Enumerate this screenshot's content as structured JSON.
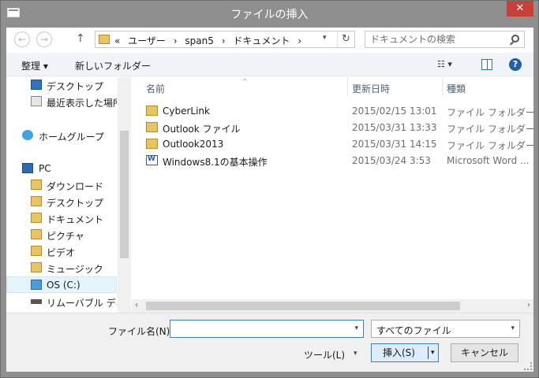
{
  "window": {
    "title": "ファイルの挿入",
    "close_glyph": "✕"
  },
  "nav": {
    "back": "←",
    "forward": "→",
    "up": "↑"
  },
  "address": {
    "path": [
      "«",
      "ユーザー",
      "›",
      "span5",
      "›",
      "ドキュメント",
      "›"
    ],
    "refresh": "↻"
  },
  "search": {
    "placeholder": "ドキュメントの検索"
  },
  "toolbar": {
    "organize": "整理 ▾",
    "new_folder": "新しいフォルダー",
    "view": "☷ ▾",
    "help": "?"
  },
  "navpane": {
    "items": [
      {
        "label": "デスクトップ",
        "icon": "desktop-icon"
      },
      {
        "label": "最近表示した場所",
        "icon": "recent-places-icon"
      },
      {
        "label": "ホームグループ",
        "icon": "homegroup-icon"
      },
      {
        "label": "PC",
        "icon": "pc-icon"
      },
      {
        "label": "ダウンロード",
        "icon": "downloads-folder-icon"
      },
      {
        "label": "デスクトップ",
        "icon": "desktop-folder-icon"
      },
      {
        "label": "ドキュメント",
        "icon": "documents-folder-icon"
      },
      {
        "label": "ピクチャ",
        "icon": "pictures-folder-icon"
      },
      {
        "label": "ビデオ",
        "icon": "videos-folder-icon"
      },
      {
        "label": "ミュージック",
        "icon": "music-folder-icon"
      },
      {
        "label": "OS (C:)",
        "icon": "drive-icon"
      },
      {
        "label": "リムーバブル ディスク",
        "icon": "removable-disk-icon"
      }
    ]
  },
  "columns": {
    "name": "名前",
    "modified": "更新日時",
    "type": "種類"
  },
  "files": [
    {
      "name": "CyberLink",
      "modified": "2015/02/15 13:01",
      "type": "ファイル フォルダー",
      "icon": "folder-icon"
    },
    {
      "name": "Outlook ファイル",
      "modified": "2015/03/31 13:33",
      "type": "ファイル フォルダー",
      "icon": "folder-icon"
    },
    {
      "name": "Outlook2013",
      "modified": "2015/03/31 14:15",
      "type": "ファイル フォルダー",
      "icon": "folder-icon"
    },
    {
      "name": "Windows8.1の基本操作",
      "modified": "2015/03/24 3:53",
      "type": "Microsoft Word ...",
      "icon": "word-document-icon"
    }
  ],
  "bottom": {
    "filename_label": "ファイル名(N):",
    "filename_value": "",
    "filetype_value": "すべてのファイル",
    "tools_label": "ツール(L)",
    "insert_label": "挿入(S)",
    "cancel_label": "キャンセル"
  }
}
